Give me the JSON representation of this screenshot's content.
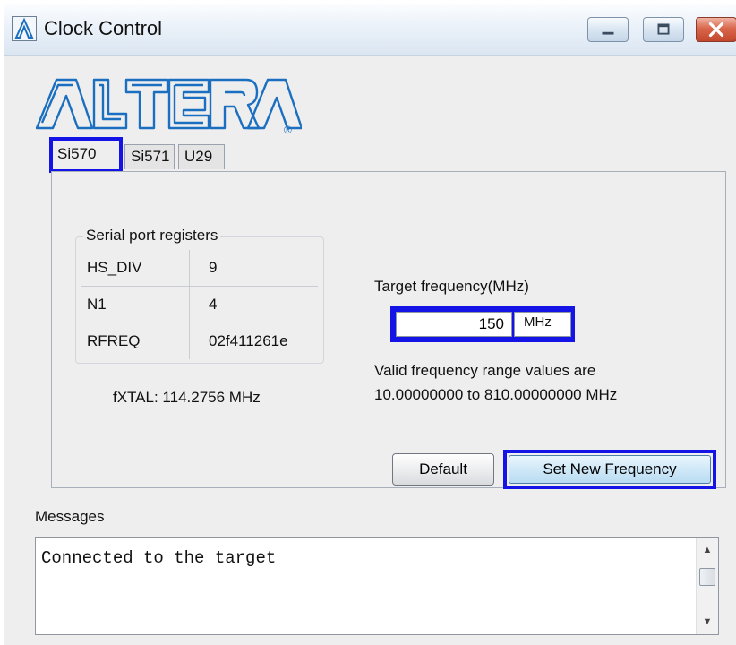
{
  "window": {
    "title": "Clock Control",
    "icon": "altera-app-icon"
  },
  "logo": {
    "text": "ALTERA",
    "mark": "®",
    "color": "#1b6fc0"
  },
  "tabs": [
    {
      "label": "Si570",
      "active": true
    },
    {
      "label": "Si571",
      "active": false
    },
    {
      "label": "U29",
      "active": false
    }
  ],
  "registers": {
    "legend": "Serial port registers",
    "rows": [
      {
        "name": "HS_DIV",
        "value": "9"
      },
      {
        "name": "N1",
        "value": "4"
      },
      {
        "name": "RFREQ",
        "value": "02f411261e"
      }
    ]
  },
  "fxtal": "fXTAL:  114.2756 MHz",
  "target": {
    "label": "Target frequency(MHz)",
    "value": "150",
    "unit": "MHz",
    "range_line1": "Valid frequency range values are",
    "range_line2": "10.00000000 to 810.00000000 MHz"
  },
  "buttons": {
    "default": "Default",
    "set_new": "Set New Frequency"
  },
  "messages": {
    "label": "Messages",
    "text": "Connected to the target"
  },
  "colors": {
    "highlight": "#1414e6"
  }
}
